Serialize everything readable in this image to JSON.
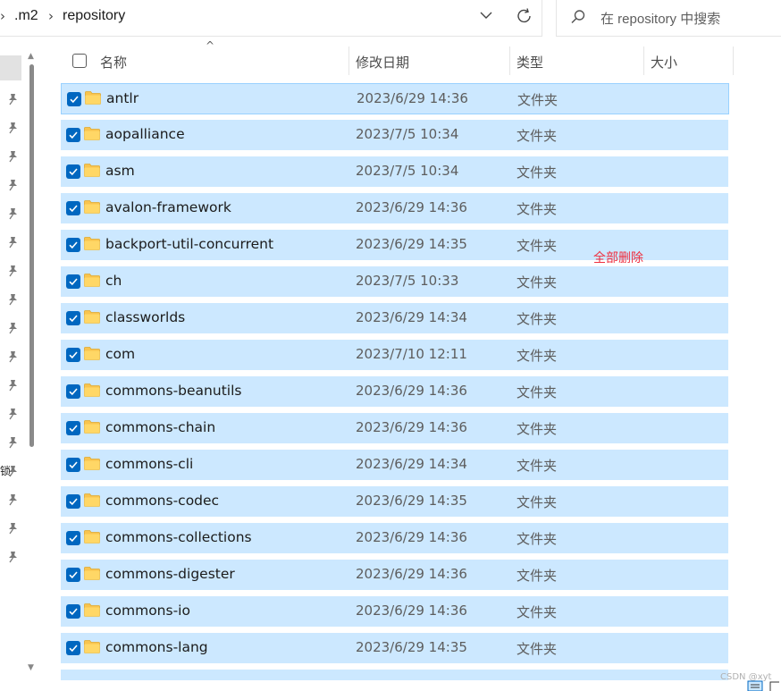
{
  "breadcrumb": {
    "items": [
      ".m2",
      "repository"
    ],
    "separator": "›"
  },
  "search": {
    "placeholder": "在 repository 中搜索"
  },
  "columns": {
    "name": "名称",
    "date": "修改日期",
    "type": "类型",
    "size": "大小"
  },
  "files": [
    {
      "name": "antlr",
      "date": "2023/6/29 14:36",
      "type": "文件夹"
    },
    {
      "name": "aopalliance",
      "date": "2023/7/5 10:34",
      "type": "文件夹"
    },
    {
      "name": "asm",
      "date": "2023/7/5 10:34",
      "type": "文件夹"
    },
    {
      "name": "avalon-framework",
      "date": "2023/6/29 14:36",
      "type": "文件夹"
    },
    {
      "name": "backport-util-concurrent",
      "date": "2023/6/29 14:35",
      "type": "文件夹"
    },
    {
      "name": "ch",
      "date": "2023/7/5 10:33",
      "type": "文件夹"
    },
    {
      "name": "classworlds",
      "date": "2023/6/29 14:34",
      "type": "文件夹"
    },
    {
      "name": "com",
      "date": "2023/7/10 12:11",
      "type": "文件夹"
    },
    {
      "name": "commons-beanutils",
      "date": "2023/6/29 14:36",
      "type": "文件夹"
    },
    {
      "name": "commons-chain",
      "date": "2023/6/29 14:36",
      "type": "文件夹"
    },
    {
      "name": "commons-cli",
      "date": "2023/6/29 14:34",
      "type": "文件夹"
    },
    {
      "name": "commons-codec",
      "date": "2023/6/29 14:35",
      "type": "文件夹"
    },
    {
      "name": "commons-collections",
      "date": "2023/6/29 14:36",
      "type": "文件夹"
    },
    {
      "name": "commons-digester",
      "date": "2023/6/29 14:36",
      "type": "文件夹"
    },
    {
      "name": "commons-io",
      "date": "2023/6/29 14:36",
      "type": "文件夹"
    },
    {
      "name": "commons-lang",
      "date": "2023/6/29 14:35",
      "type": "文件夹"
    }
  ],
  "annotation": "全部删除",
  "watermark": "CSDN @xyt",
  "nav_fragment": "锁",
  "icons": {
    "pin": "pin-icon",
    "folder": "folder-icon",
    "checkbox": "checkbox-checked-icon",
    "refresh": "refresh-icon",
    "search": "search-icon"
  },
  "colors": {
    "selection_bg": "#cce8ff",
    "selection_border": "#99d1ff",
    "checkbox": "#0067c0",
    "folder": "#f8c44f",
    "annotation": "#ef2f3f"
  }
}
